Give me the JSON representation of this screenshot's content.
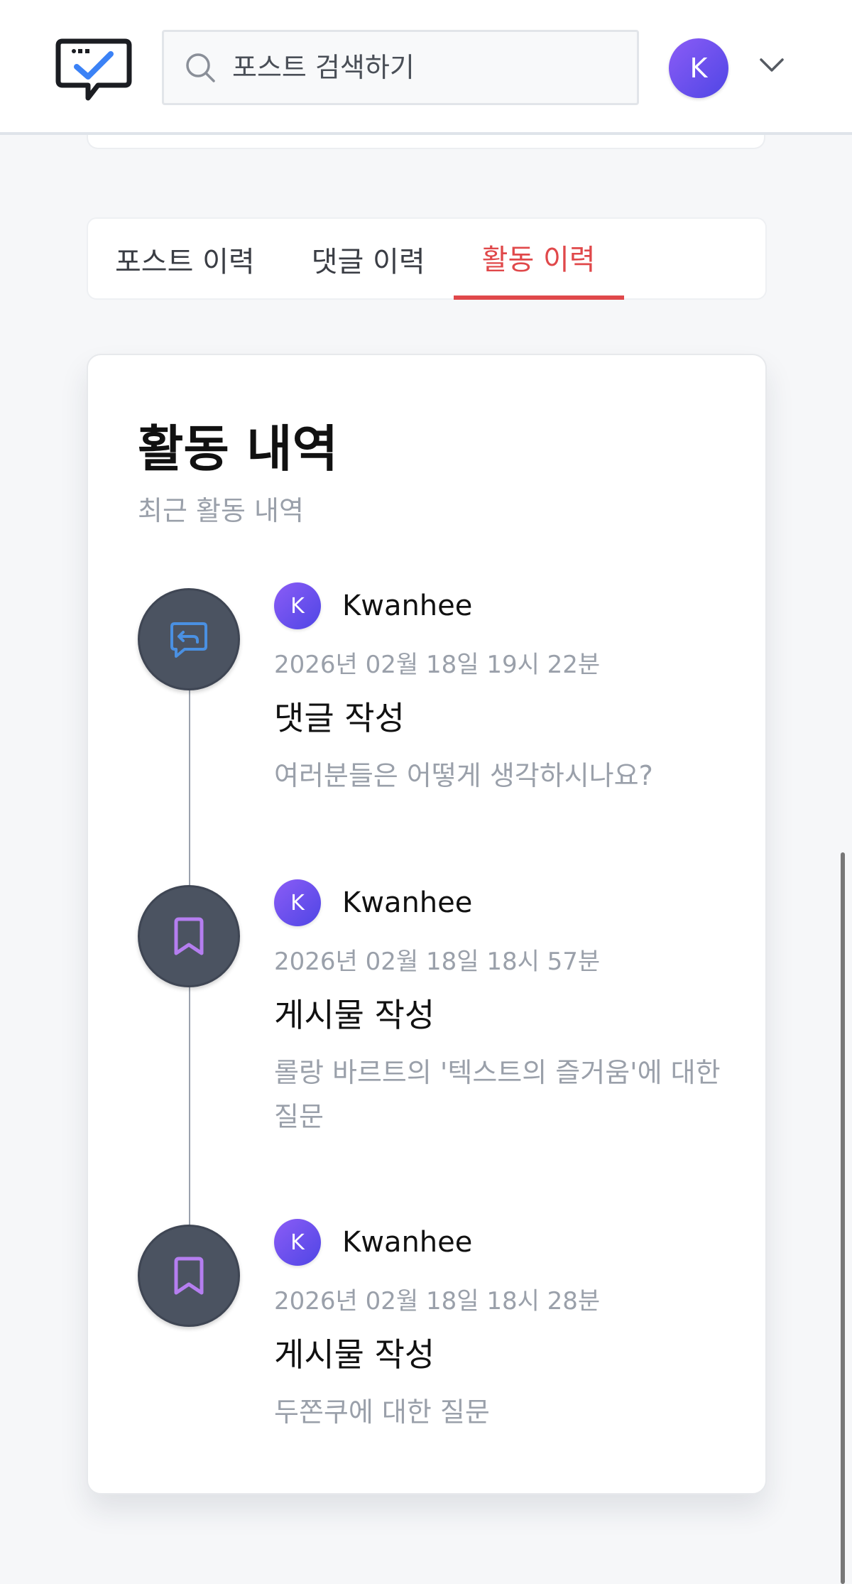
{
  "header": {
    "search": {
      "placeholder": "포스트 검색하기"
    },
    "user_initial": "K"
  },
  "tabs": [
    {
      "label": "포스트 이력"
    },
    {
      "label": "댓글 이력"
    },
    {
      "label": "활동 이력",
      "active": true
    }
  ],
  "activity": {
    "title": "활동 내역",
    "subtitle": "최근 활동 내역",
    "items": [
      {
        "icon": "reply-icon",
        "user_initial": "K",
        "user": "Kwanhee",
        "date": "2026년 02월 18일 19시 22분",
        "action": "댓글 작성",
        "description": "여러분들은 어떻게 생각하시나요?"
      },
      {
        "icon": "bookmark-icon",
        "user_initial": "K",
        "user": "Kwanhee",
        "date": "2026년 02월 18일 18시 57분",
        "action": "게시물 작성",
        "description": "롤랑 바르트의 '텍스트의 즐거움'에 대한 질문"
      },
      {
        "icon": "bookmark-icon",
        "user_initial": "K",
        "user": "Kwanhee",
        "date": "2026년 02월 18일 18시 28분",
        "action": "게시물 작성",
        "description": "두쫀쿠에 대한 질문"
      }
    ]
  },
  "colors": {
    "accent": "#e0484a",
    "avatar": "#6d4ff0",
    "reply_icon": "#4a90e2",
    "bookmark_icon": "#b57ef0"
  }
}
